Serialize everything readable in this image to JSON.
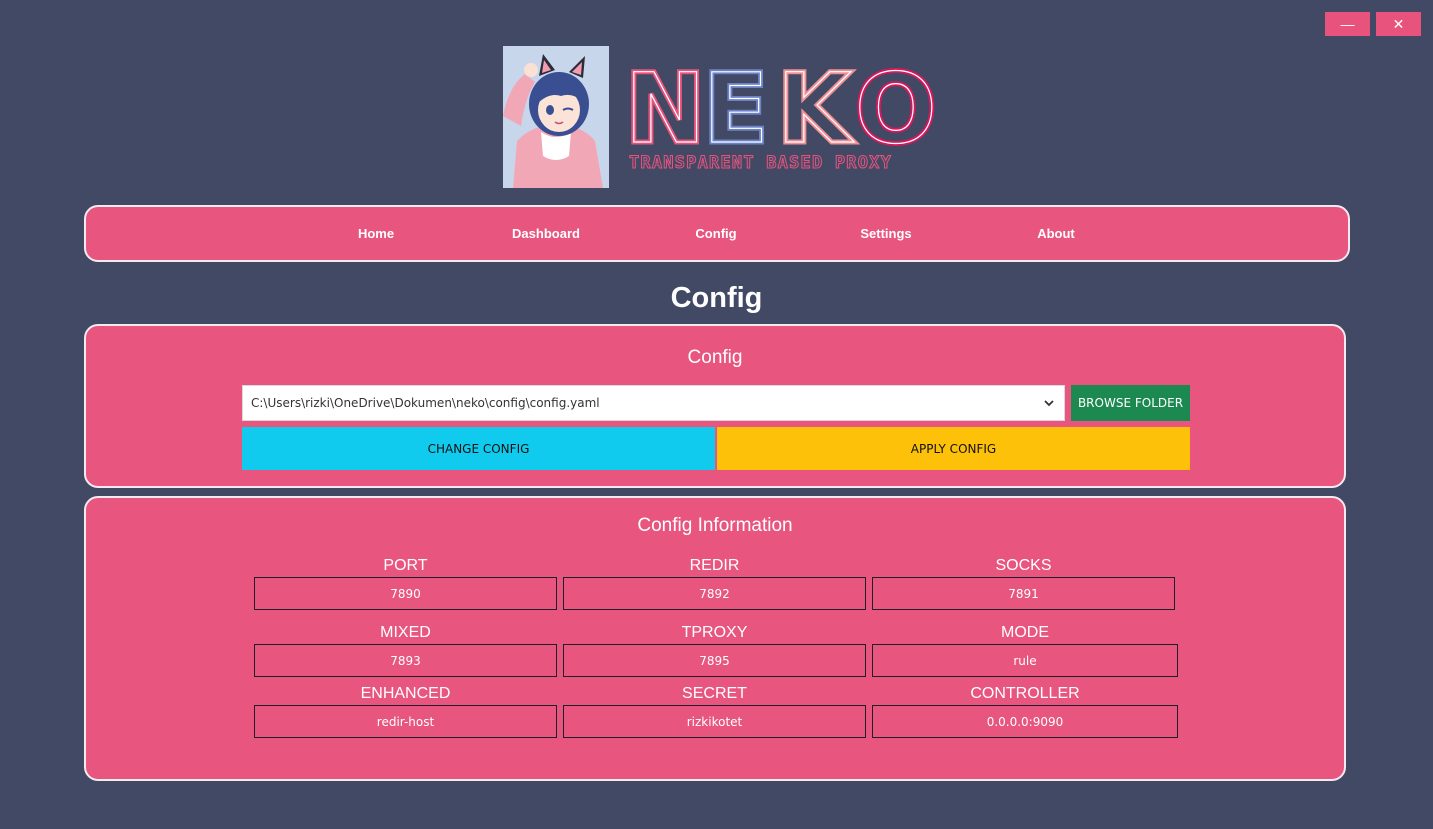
{
  "window": {
    "minimize_glyph": "—",
    "close_glyph": "✕"
  },
  "logo": {
    "title": "NEKO",
    "tagline": "TRANSPARENT BASED PROXY",
    "colors": {
      "pink": "#e8537e",
      "blue": "#6b82c7",
      "salmon": "#ee8f95",
      "crimson": "#d2195e"
    }
  },
  "nav": {
    "items": [
      {
        "label": "Home"
      },
      {
        "label": "Dashboard"
      },
      {
        "label": "Config"
      },
      {
        "label": "Settings"
      },
      {
        "label": "About"
      }
    ]
  },
  "page_title": "Config",
  "config_panel": {
    "heading": "Config",
    "path_value": "C:\\Users\\rizki\\OneDrive\\Dokumen\\neko\\config\\config.yaml",
    "browse_label": "BROWSE FOLDER",
    "change_label": "CHANGE CONFIG",
    "apply_label": "APPLY CONFIG"
  },
  "info_panel": {
    "heading": "Config Information",
    "fields": [
      {
        "label": "PORT",
        "value": "7890"
      },
      {
        "label": "REDIR",
        "value": "7892"
      },
      {
        "label": "SOCKS",
        "value": "7891"
      },
      {
        "label": "MIXED",
        "value": "7893"
      },
      {
        "label": "TPROXY",
        "value": "7895"
      },
      {
        "label": "MODE",
        "value": "rule"
      },
      {
        "label": "ENHANCED",
        "value": "redir-host"
      },
      {
        "label": "SECRET",
        "value": "rizkikotet"
      },
      {
        "label": "CONTROLLER",
        "value": "0.0.0.0:9090"
      }
    ]
  },
  "colors": {
    "background": "#424965",
    "panel": "#e8557f",
    "browse": "#1c8a50",
    "change": "#11cbef",
    "apply": "#fdc10a"
  }
}
